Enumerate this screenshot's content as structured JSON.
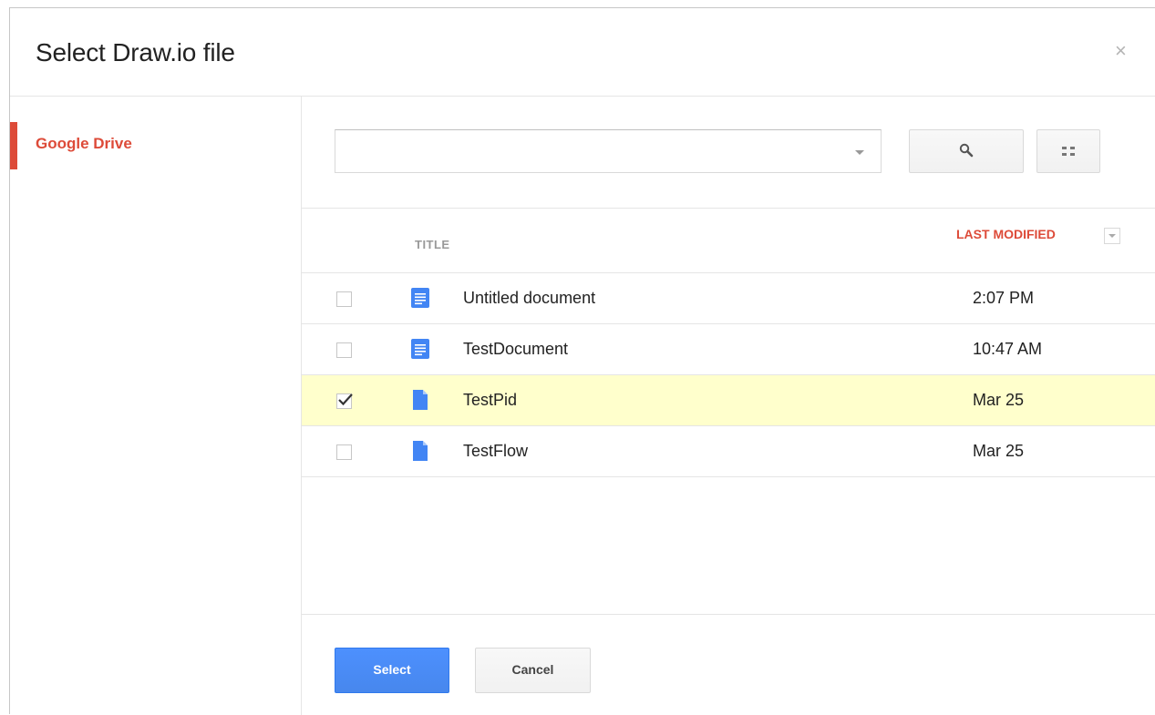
{
  "dialog": {
    "title": "Select Draw.io file",
    "close_symbol": "×"
  },
  "sidebar": {
    "items": [
      {
        "label": "Google Drive",
        "active": true,
        "accent": "#dd4b39"
      }
    ]
  },
  "search": {
    "value": "",
    "placeholder": "",
    "search_icon": "magnifier-icon",
    "view_icon": "grid-view-icon"
  },
  "list": {
    "columns": {
      "title": "TITLE",
      "modified": "LAST MODIFIED"
    },
    "rows": [
      {
        "name": "Untitled document",
        "modified": "2:07 PM",
        "checked": false,
        "icon": "google-doc-icon"
      },
      {
        "name": "TestDocument",
        "modified": "10:47 AM",
        "checked": false,
        "icon": "google-doc-icon"
      },
      {
        "name": "TestPid",
        "modified": "Mar 25",
        "checked": true,
        "icon": "file-icon"
      },
      {
        "name": "TestFlow",
        "modified": "Mar 25",
        "checked": false,
        "icon": "file-icon"
      }
    ]
  },
  "footer": {
    "select_label": "Select",
    "cancel_label": "Cancel"
  },
  "colors": {
    "accent_red": "#dd4b39",
    "primary_blue": "#4d90fe",
    "selected_row": "#ffffcc",
    "doc_icon_blue": "#4285f4"
  }
}
